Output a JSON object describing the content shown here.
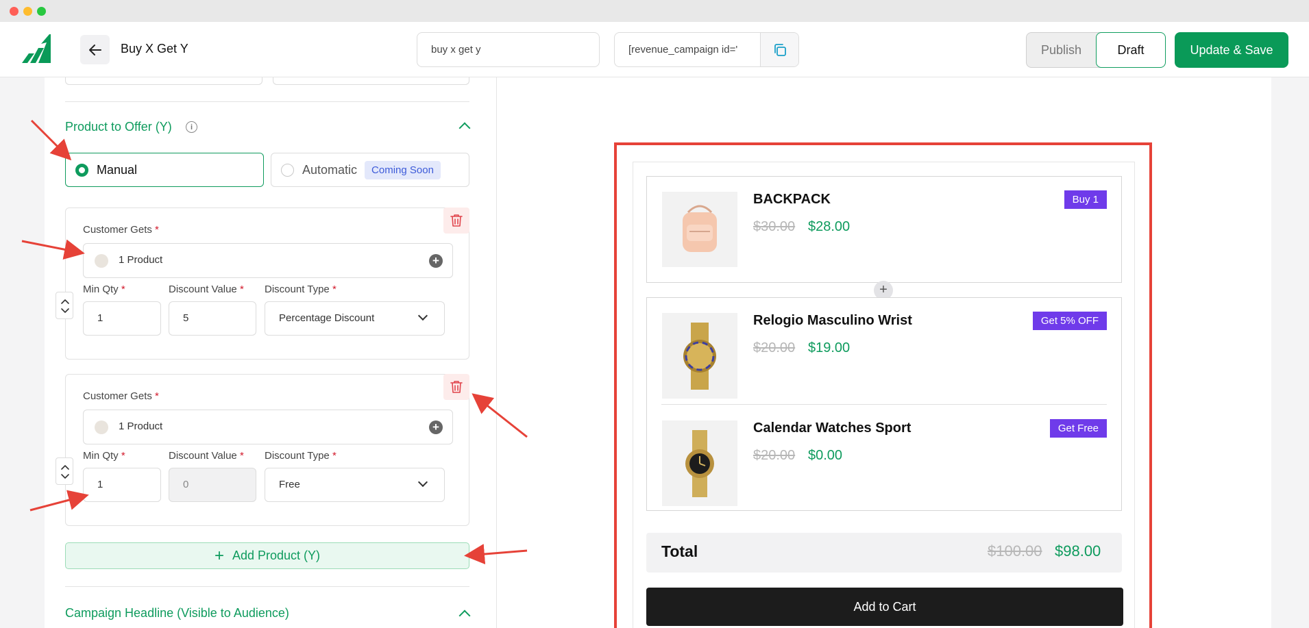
{
  "window": {
    "traffic_lights": [
      "#ff5f57",
      "#febc2e",
      "#28c840"
    ]
  },
  "header": {
    "title": "Buy X Get Y",
    "campaign_name_value": "buy x get y",
    "shortcode_value": "[revenue_campaign id='",
    "publish_label": "Publish",
    "draft_label": "Draft",
    "save_label": "Update & Save",
    "accent_color": "#0a9a58"
  },
  "offer_section": {
    "title": "Product to Offer (Y)",
    "manual_label": "Manual",
    "automatic_label": "Automatic",
    "coming_soon_label": "Coming Soon",
    "selected_mode": "Manual"
  },
  "offer_items": [
    {
      "customer_gets_label": "Customer Gets",
      "product_count": "1 Product",
      "min_qty_label": "Min Qty",
      "discount_value_label": "Discount Value",
      "discount_type_label": "Discount Type",
      "min_qty": "1",
      "discount_value": "5",
      "discount_type": "Percentage Discount"
    },
    {
      "customer_gets_label": "Customer Gets",
      "product_count": "1 Product",
      "min_qty_label": "Min Qty",
      "discount_value_label": "Discount Value",
      "discount_type_label": "Discount Type",
      "min_qty": "1",
      "discount_value": "0",
      "discount_type": "Free"
    }
  ],
  "add_product_label": "Add Product (Y)",
  "headline_section_title": "Campaign Headline (Visible to Audience)",
  "preview": {
    "products": [
      {
        "name": "BACKPACK",
        "old_price": "$30.00",
        "new_price": "$28.00",
        "badge": "Buy 1"
      },
      {
        "name": "Relogio Masculino Wrist",
        "old_price": "$20.00",
        "new_price": "$19.00",
        "badge": "Get 5% OFF"
      },
      {
        "name": "Calendar Watches Sport",
        "old_price": "$20.00",
        "new_price": "$0.00",
        "badge": "Get Free"
      }
    ],
    "total_label": "Total",
    "total_old": "$100.00",
    "total_new": "$98.00",
    "add_to_cart_label": "Add to Cart",
    "badge_color": "#6f3bea",
    "highlight_color": "#e64238"
  }
}
